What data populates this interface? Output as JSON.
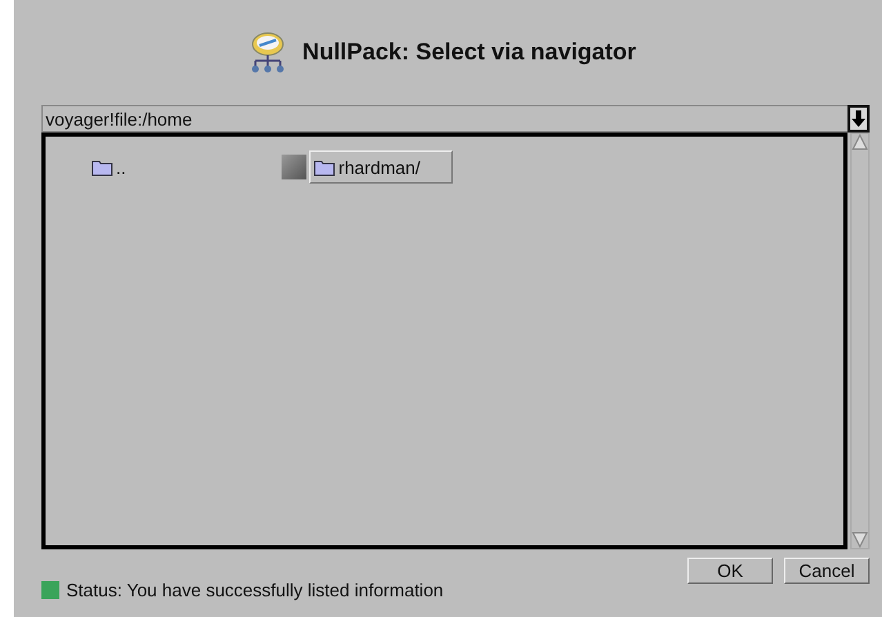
{
  "window": {
    "title": "NullPack: Select via navigator"
  },
  "path_field": {
    "value": "voyager!file:/home"
  },
  "items": [
    {
      "label": "..",
      "selected": false
    },
    {
      "label": "rhardman/",
      "selected": true
    }
  ],
  "buttons": [
    "OK",
    "Cancel"
  ],
  "status": {
    "text": "Status: You have successfully listed information",
    "color": "#3aa45a"
  }
}
